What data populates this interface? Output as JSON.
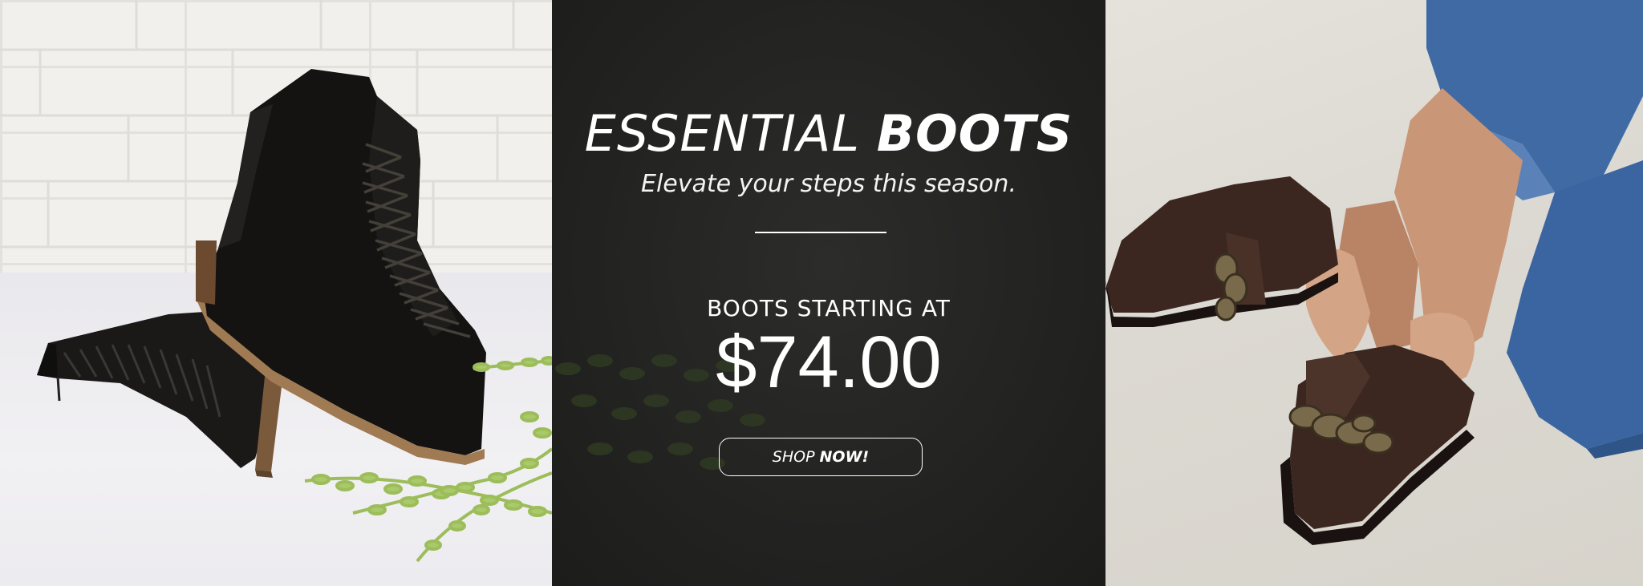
{
  "banner": {
    "headline_light": "ESSENTIAL",
    "headline_bold": "BOOTS",
    "subline": "Elevate your steps this season.",
    "price_label": "BOOTS STARTING AT",
    "price": "$74.00",
    "cta_light": "SHOP",
    "cta_bold": "NOW!"
  },
  "colors": {
    "center_panel": "#232322",
    "text": "#ffffff",
    "black_boot": "#151413",
    "brown_loafer": "#3b2620",
    "chain_metal": "#7a6a4c",
    "denim": "#3f6aa3",
    "foliage": "#a9c96a"
  },
  "images": {
    "left": "black-lace-up-ankle-boots-photo",
    "right": "brown-chain-loafers-on-feet-photo"
  }
}
